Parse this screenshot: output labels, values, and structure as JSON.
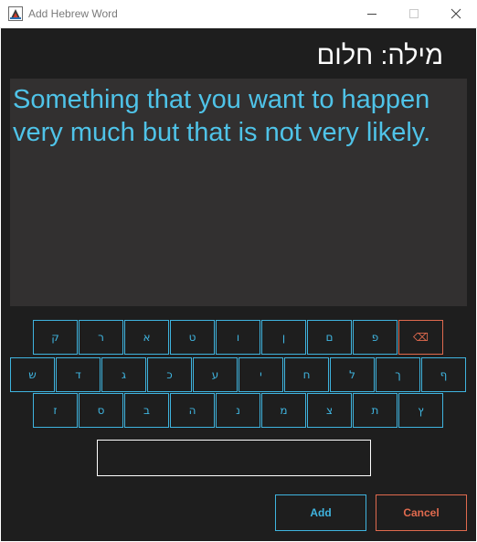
{
  "window": {
    "title": "Add Hebrew Word",
    "icon": "java-app-icon"
  },
  "header": {
    "word_label": "מילה: חלום"
  },
  "definition": {
    "text": "Something that you want to happen very much but that is not very likely."
  },
  "keyboard": {
    "rows": [
      [
        "ק",
        "ר",
        "א",
        "ט",
        "ו",
        "ן",
        "ם",
        "פ",
        "⌫"
      ],
      [
        "ש",
        "ד",
        "ג",
        "כ",
        "ע",
        "י",
        "ח",
        "ל",
        "ך",
        "ף"
      ],
      [
        "ז",
        "ס",
        "ב",
        "ה",
        "נ",
        "מ",
        "צ",
        "ת",
        "ץ"
      ]
    ]
  },
  "input": {
    "value": "",
    "placeholder": ""
  },
  "buttons": {
    "add_label": "Add",
    "cancel_label": "Cancel"
  },
  "colors": {
    "background": "#1e1e1e",
    "panel": "#323030",
    "accent": "#3fb4df",
    "danger": "#e06a4e",
    "text": "#ffffff"
  }
}
